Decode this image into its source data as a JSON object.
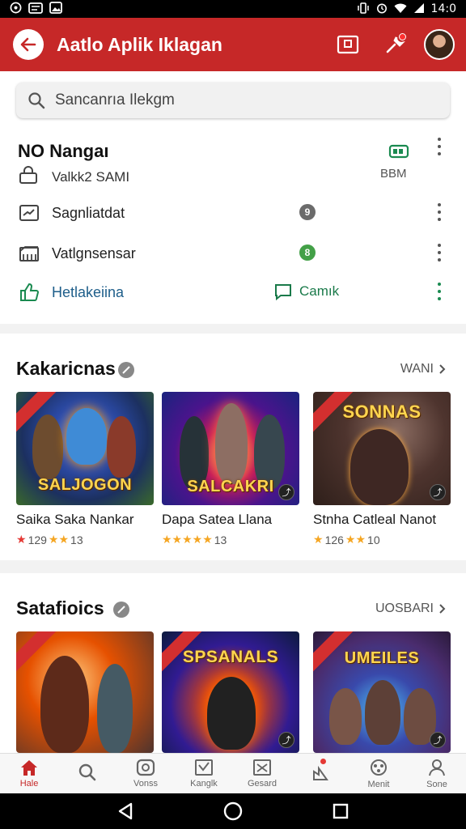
{
  "statusbar": {
    "time": "14:0",
    "left_icons": [
      "whatsapp-icon",
      "message-icon",
      "image-icon"
    ],
    "right_icons": [
      "vibrate-icon",
      "alarm-icon",
      "wifi-icon",
      "signal-icon"
    ]
  },
  "appbar": {
    "title": "Aatlo Aplik Iklagan"
  },
  "search": {
    "placeholder": "Sancanrıa Ilekgm"
  },
  "settings": {
    "header_title": "NO Nangaı",
    "header_sub": "Valkk2 SAMI",
    "header_right": "BBM",
    "rows": [
      {
        "label": "Sagnliatdat",
        "badge": "9"
      },
      {
        "label": "Vatlgnsensar",
        "badge": "8"
      }
    ],
    "link_label": "Hetlakeiina",
    "chat_label": "Camık"
  },
  "sections": [
    {
      "title": "Kakaricnas",
      "see_all": "WANI",
      "games": [
        {
          "name": "Saika Saka Nankar",
          "rating": "129",
          "rating_tail": "13",
          "logo": "SALJOGON"
        },
        {
          "name": "Dapa Satea Llana",
          "rating": "",
          "rating_tail": "13",
          "logo": "SALCAKRI"
        },
        {
          "name": "Stnha Catleal Nanot",
          "rating": "126",
          "rating_tail": "10",
          "logo": "SONNAS"
        }
      ]
    },
    {
      "title": "Satafioics",
      "see_all": "UOSBARI",
      "games": [
        {
          "name": "",
          "logo": ""
        },
        {
          "name": "",
          "logo": "SPSANALS"
        },
        {
          "name": "",
          "logo": "UMEILES"
        }
      ]
    }
  ],
  "bottomnav": [
    {
      "label": "Hale",
      "icon": "home-icon",
      "active": true
    },
    {
      "label": "",
      "icon": "search-icon",
      "active": false
    },
    {
      "label": "Vonss",
      "icon": "games-icon",
      "active": false
    },
    {
      "label": "Kanglk",
      "icon": "chart-icon",
      "active": false
    },
    {
      "label": "Gesard",
      "icon": "grid-icon",
      "active": false
    },
    {
      "label": "",
      "icon": "bell-icon",
      "active": false
    },
    {
      "label": "Menit",
      "icon": "gamepad-icon",
      "active": false
    },
    {
      "label": "Sone",
      "icon": "person-icon",
      "active": false
    }
  ],
  "colors": {
    "brand": "#c62828",
    "link": "#1e5e8a",
    "chat": "#1a7a4a",
    "star": "#f5a623"
  }
}
